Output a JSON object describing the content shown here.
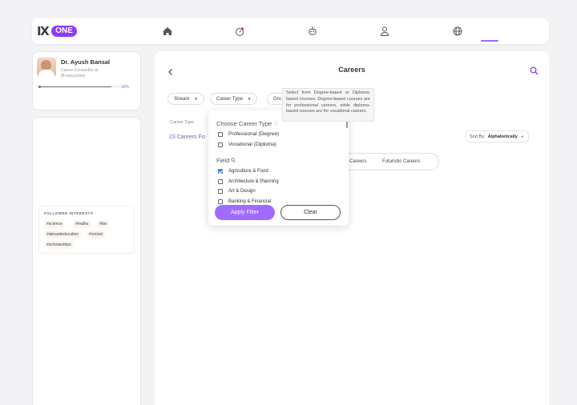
{
  "brand": {
    "ix": "IX",
    "one": "ONE"
  },
  "nav": [
    "home-icon",
    "gauge-icon",
    "robot-icon",
    "user-icon",
    "globe-icon"
  ],
  "profile": {
    "name": "Dr. Ayush Bansal",
    "role": "Career Counsellor at",
    "org": "iB-easycareer",
    "progress": 0.9,
    "progress_label": "90%"
  },
  "interests": {
    "title": "FOLLOWED INTERESTS",
    "tags": [
      "#science",
      "#maths",
      "#bio",
      "#abroadeducation",
      "#cricket",
      "#scholarships"
    ]
  },
  "page": {
    "title": "Careers"
  },
  "filters": {
    "stream": "Stream",
    "career_type": "Career Type",
    "group": "Gro"
  },
  "career_type_label": "Career Type",
  "result_count": "23 Careers Fo",
  "sort": {
    "label": "Sort By:",
    "value": "Alphabetically"
  },
  "tabs": [
    "Careers",
    "Futuristic Careers"
  ],
  "dropdown": {
    "heading": "Choose Career Type",
    "options": [
      {
        "label": "Professional (Degree)",
        "checked": false
      },
      {
        "label": "Vocational (Diploma)",
        "checked": false
      }
    ],
    "field_heading": "Field",
    "fields": [
      {
        "label": "Agriculture & Food",
        "checked": true
      },
      {
        "label": "Architecture & Planning",
        "checked": false
      },
      {
        "label": "Art & Design",
        "checked": false
      },
      {
        "label": "Banking & Financial",
        "checked": false
      }
    ],
    "apply": "Apply Filter",
    "clear": "Clear"
  },
  "tooltip": "Select from Degree-based or Diploma-based courses. Degree-based courses are for professional careers, while diploma-based courses are for vocational careers.",
  "accent": "#a764ff"
}
